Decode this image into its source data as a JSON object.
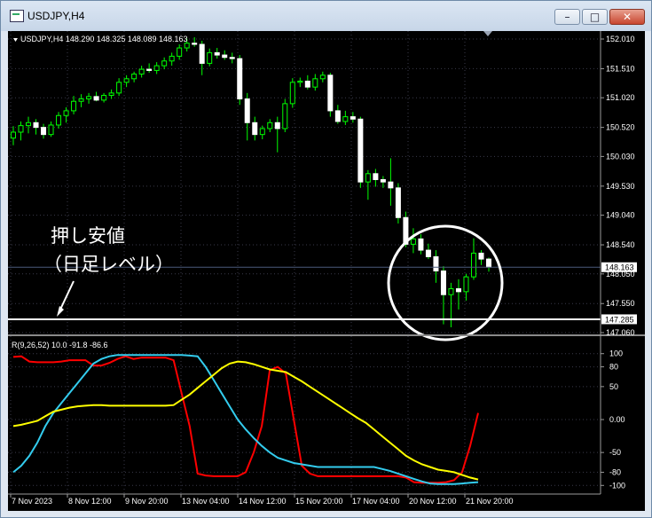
{
  "window": {
    "title": "USDJPY,H4",
    "buttons": {
      "minimize": "–",
      "maximize": "□",
      "close": "✕"
    }
  },
  "price_panel": {
    "header": "USDJPY,H4  148.290 148.325 148.089 148.163",
    "price_ticks": [
      "152.010",
      "151.510",
      "151.020",
      "150.520",
      "150.030",
      "149.530",
      "149.040",
      "148.540",
      "148.050",
      "147.550",
      "147.060"
    ],
    "current_price": "148.163",
    "level_price": "147.285",
    "annotation_line1": "押し安値",
    "annotation_line2": "（日足レベル）"
  },
  "indicator_panel": {
    "header": "R(9,26,52) 10.0 -91.8 -86.6",
    "ticks": [
      "100",
      "80",
      "50",
      "0.00",
      "-50",
      "-80",
      "-100"
    ]
  },
  "time_axis": {
    "labels": [
      "7 Nov 2023",
      "8 Nov 12:00",
      "9 Nov 20:00",
      "13 Nov 04:00",
      "14 Nov 12:00",
      "15 Nov 20:00",
      "17 Nov 04:00",
      "20 Nov 12:00",
      "21 Nov 20:00"
    ]
  },
  "colors": {
    "background": "#000000",
    "candle": "#ffffff",
    "wick": "#00ff00",
    "red_line": "#ff0000",
    "cyan_line": "#33ccee",
    "yellow_line": "#ffff00",
    "axis_text": "#ffffff"
  },
  "chart_data": [
    {
      "type": "candlestick",
      "symbol": "USDJPY",
      "timeframe": "H4",
      "ylim": [
        147.06,
        152.01
      ],
      "candles": [
        [
          150.34,
          150.54,
          150.22,
          150.44
        ],
        [
          150.44,
          150.62,
          150.3,
          150.55
        ],
        [
          150.55,
          150.7,
          150.42,
          150.6
        ],
        [
          150.6,
          150.66,
          150.4,
          150.52
        ],
        [
          150.52,
          150.58,
          150.33,
          150.4
        ],
        [
          150.4,
          150.62,
          150.36,
          150.56
        ],
        [
          150.56,
          150.78,
          150.5,
          150.72
        ],
        [
          150.72,
          150.86,
          150.6,
          150.8
        ],
        [
          150.8,
          151.05,
          150.74,
          150.96
        ],
        [
          150.96,
          151.08,
          150.86,
          151.0
        ],
        [
          151.0,
          151.1,
          150.92,
          151.04
        ],
        [
          151.04,
          151.12,
          150.96,
          150.98
        ],
        [
          150.98,
          151.1,
          150.94,
          151.06
        ],
        [
          151.06,
          151.16,
          151.0,
          151.1
        ],
        [
          151.1,
          151.35,
          151.05,
          151.28
        ],
        [
          151.28,
          151.4,
          151.2,
          151.34
        ],
        [
          151.34,
          151.46,
          151.28,
          151.42
        ],
        [
          151.42,
          151.56,
          151.36,
          151.5
        ],
        [
          151.5,
          151.6,
          151.44,
          151.48
        ],
        [
          151.48,
          151.62,
          151.42,
          151.56
        ],
        [
          151.56,
          151.7,
          151.5,
          151.64
        ],
        [
          151.64,
          151.78,
          151.56,
          151.72
        ],
        [
          151.72,
          151.92,
          151.66,
          151.86
        ],
        [
          151.86,
          152.02,
          151.8,
          151.94
        ],
        [
          151.94,
          152.04,
          151.88,
          151.92
        ],
        [
          151.92,
          151.98,
          151.4,
          151.6
        ],
        [
          151.6,
          151.85,
          151.55,
          151.78
        ],
        [
          151.78,
          151.86,
          151.68,
          151.74
        ],
        [
          151.74,
          151.82,
          151.66,
          151.7
        ],
        [
          151.7,
          151.78,
          151.6,
          151.68
        ],
        [
          151.68,
          151.74,
          150.9,
          151.0
        ],
        [
          151.0,
          151.1,
          150.3,
          150.6
        ],
        [
          150.6,
          150.7,
          150.3,
          150.4
        ],
        [
          150.4,
          150.55,
          150.32,
          150.5
        ],
        [
          150.5,
          150.66,
          150.44,
          150.6
        ],
        [
          150.6,
          150.7,
          150.1,
          150.5
        ],
        [
          150.5,
          151.0,
          150.44,
          150.92
        ],
        [
          150.92,
          151.35,
          150.85,
          151.28
        ],
        [
          151.28,
          151.36,
          151.2,
          151.3
        ],
        [
          151.3,
          151.4,
          151.16,
          151.2
        ],
        [
          151.2,
          151.42,
          151.14,
          151.34
        ],
        [
          151.34,
          151.46,
          151.28,
          151.4
        ],
        [
          151.4,
          151.44,
          150.7,
          150.8
        ],
        [
          150.8,
          150.9,
          150.58,
          150.62
        ],
        [
          150.62,
          150.8,
          150.56,
          150.7
        ],
        [
          150.7,
          150.78,
          150.6,
          150.66
        ],
        [
          150.66,
          150.7,
          149.5,
          149.6
        ],
        [
          149.6,
          149.8,
          149.3,
          149.74
        ],
        [
          149.74,
          149.82,
          149.52,
          149.64
        ],
        [
          149.64,
          149.7,
          149.5,
          149.6
        ],
        [
          149.6,
          150.0,
          149.2,
          149.5
        ],
        [
          149.5,
          149.58,
          148.9,
          149.0
        ],
        [
          149.0,
          149.1,
          148.5,
          148.55
        ],
        [
          148.55,
          148.82,
          148.4,
          148.64
        ],
        [
          148.64,
          148.72,
          148.38,
          148.45
        ],
        [
          148.45,
          148.56,
          148.3,
          148.34
        ],
        [
          148.34,
          148.45,
          147.9,
          148.1
        ],
        [
          148.1,
          148.18,
          147.2,
          147.7
        ],
        [
          147.7,
          147.9,
          147.15,
          147.8
        ],
        [
          147.8,
          147.96,
          147.45,
          147.75
        ],
        [
          147.75,
          148.05,
          147.6,
          148.0
        ],
        [
          148.0,
          148.65,
          147.95,
          148.4
        ],
        [
          148.4,
          148.45,
          148.2,
          148.3
        ],
        [
          148.3,
          148.325,
          148.089,
          148.163
        ]
      ],
      "current_price": 148.163,
      "level_price": 147.285
    },
    {
      "type": "line",
      "title": "R(9,26,52)",
      "ylim": [
        -105,
        105
      ],
      "last_values": [
        10.0,
        -91.8,
        -86.6
      ],
      "series": [
        {
          "color": "#ff0000",
          "values": [
            95,
            96,
            88,
            87,
            87,
            87,
            88,
            90,
            90,
            90,
            82,
            82,
            86,
            92,
            96,
            92,
            94,
            94,
            94,
            94,
            90,
            40,
            -10,
            -82,
            -85,
            -86,
            -86,
            -86,
            -86,
            -80,
            -50,
            -10,
            75,
            80,
            70,
            0,
            -70,
            -82,
            -86,
            -86,
            -86,
            -86,
            -86,
            -86,
            -86,
            -86,
            -86,
            -86,
            -86,
            -88,
            -95,
            -96,
            -96,
            -96,
            -95,
            -92,
            -80,
            -40,
            10
          ]
        },
        {
          "color": "#33ccee",
          "values": [
            -80,
            -70,
            -55,
            -35,
            -10,
            10,
            25,
            40,
            55,
            70,
            85,
            92,
            96,
            98,
            98,
            98,
            98,
            98,
            98,
            98,
            98,
            98,
            97,
            96,
            80,
            60,
            40,
            20,
            0,
            -15,
            -28,
            -40,
            -50,
            -58,
            -62,
            -66,
            -68,
            -70,
            -72,
            -72,
            -72,
            -72,
            -72,
            -72,
            -72,
            -72,
            -75,
            -78,
            -82,
            -86,
            -90,
            -94,
            -97,
            -98,
            -98,
            -98,
            -97,
            -96,
            -95
          ]
        },
        {
          "color": "#ffff00",
          "values": [
            -10,
            -8,
            -5,
            -2,
            5,
            12,
            15,
            18,
            20,
            21,
            22,
            22,
            21,
            21,
            21,
            21,
            21,
            21,
            21,
            21,
            22,
            30,
            38,
            48,
            58,
            68,
            78,
            85,
            88,
            87,
            84,
            80,
            76,
            74,
            72,
            65,
            58,
            50,
            42,
            34,
            26,
            18,
            10,
            2,
            -5,
            -15,
            -25,
            -35,
            -45,
            -55,
            -62,
            -68,
            -72,
            -76,
            -78,
            -80,
            -84,
            -88,
            -91
          ]
        }
      ]
    }
  ]
}
